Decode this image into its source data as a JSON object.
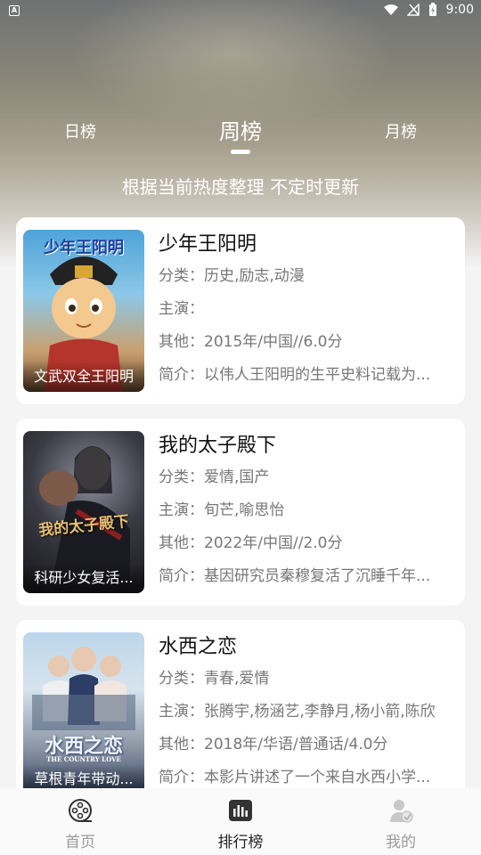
{
  "status_bar": {
    "time": "9:00"
  },
  "tabs": [
    {
      "label": "日榜"
    },
    {
      "label": "周榜"
    },
    {
      "label": "月榜"
    }
  ],
  "subtitle": "根据当前热度整理 不定时更新",
  "items": [
    {
      "poster_title": "少年王阳明",
      "poster_caption": "文武双全王阳明",
      "title": "少年王阳明",
      "category_label": "分类：",
      "category": "历史,励志,动漫",
      "cast_label": "主演：",
      "cast": "",
      "other_label": "其他：",
      "other": "2015年/中国//6.0分",
      "intro_label": "简介：",
      "intro": "以伟人王阳明的生平史料记载为..."
    },
    {
      "poster_title": "我的太子殿下",
      "poster_caption": "科研少女复活...",
      "title": "我的太子殿下",
      "category_label": "分类：",
      "category": "爱情,国产",
      "cast_label": "主演：",
      "cast": "旬芒,喻思怡",
      "other_label": "其他：",
      "other": "2022年/中国//2.0分",
      "intro_label": "简介：",
      "intro": "基因研究员秦穆复活了沉睡千年..."
    },
    {
      "poster_title": "水西之恋",
      "poster_subtitle": "THE COUNTRY LOVE",
      "poster_caption": "草根青年带动...",
      "title": "水西之恋",
      "category_label": "分类：",
      "category": "青春,爱情",
      "cast_label": "主演：",
      "cast": "张腾宇,杨涵艺,李静月,杨小箭,陈欣",
      "other_label": "其他：",
      "other": "2018年/华语/普通话/4.0分",
      "intro_label": "简介：",
      "intro": "本影片讲述了一个来自水西小学..."
    }
  ],
  "bottom_nav": [
    {
      "label": "首页",
      "icon": "film-reel-icon"
    },
    {
      "label": "排行榜",
      "icon": "ranking-chart-icon"
    },
    {
      "label": "我的",
      "icon": "user-icon"
    }
  ],
  "colors": {
    "active": "#222222",
    "inactive": "#9a9a9a",
    "card": "#ffffff"
  }
}
